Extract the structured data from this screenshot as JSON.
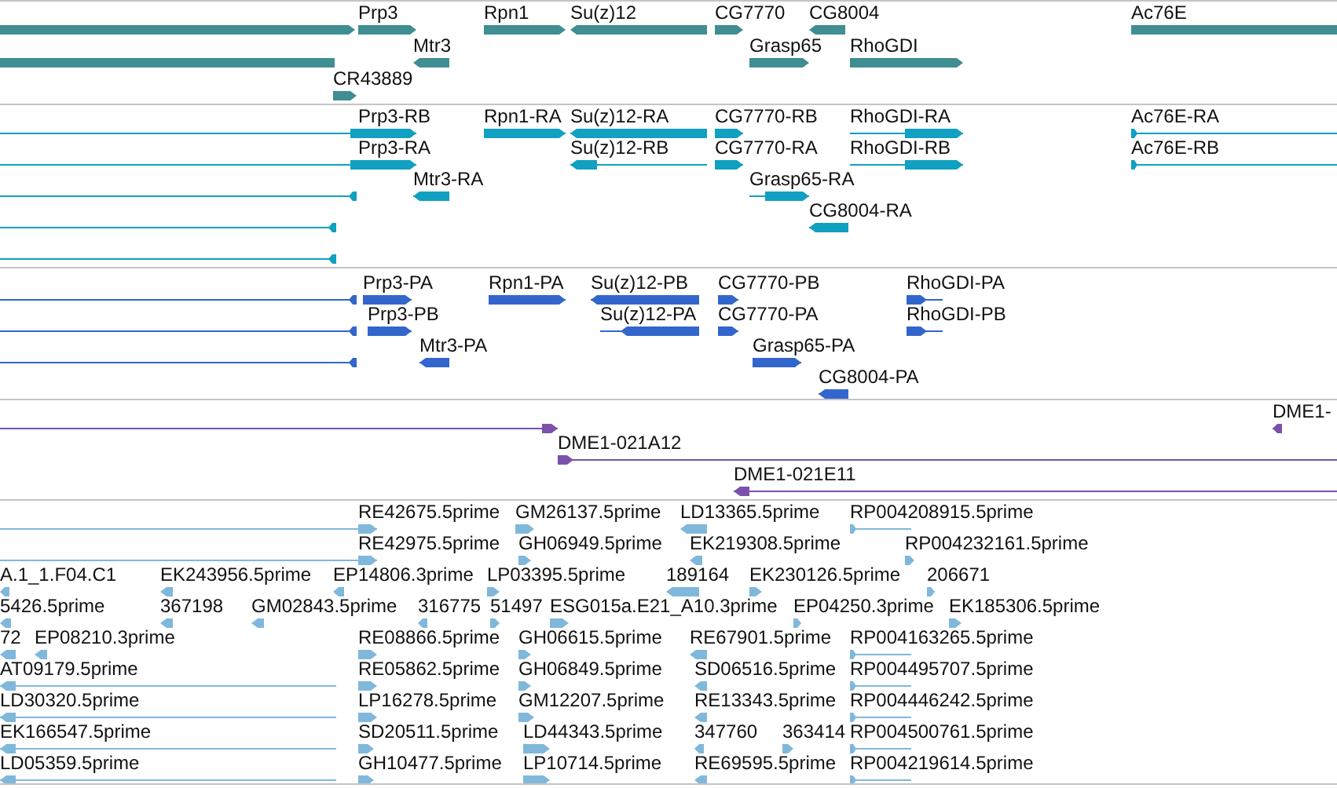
{
  "tracks": [
    {
      "kind": "gene",
      "color": "#3f8e91",
      "features": [
        {
          "reverse": false
        },
        {
          "label": "Prp3",
          "reverse": false
        },
        {
          "label": "Rpn1",
          "reverse": false
        },
        {
          "label": "Su(z)12",
          "reverse": true
        },
        {
          "label": "CG7770",
          "reverse": false
        },
        {
          "label": "CG8004",
          "reverse": true
        },
        {
          "label": "Ac76E",
          "reverse": false
        },
        {
          "reverse": true
        },
        {
          "label": "Mtr3",
          "reverse": true
        },
        {
          "label": "Grasp65",
          "reverse": false
        },
        {
          "label": "RhoGDI",
          "reverse": false
        },
        {
          "label": "CR43889",
          "reverse": false
        }
      ]
    },
    {
      "kind": "transcript",
      "color": "#10a0c0",
      "features": [
        {
          "label": "Prp3-RB",
          "reverse": false
        },
        {
          "label": "Rpn1-RA",
          "reverse": false
        },
        {
          "label": "Su(z)12-RA",
          "reverse": true
        },
        {
          "label": "CG7770-RB",
          "reverse": false
        },
        {
          "label": "RhoGDI-RA",
          "reverse": false
        },
        {
          "label": "Ac76E-RA",
          "reverse": false
        },
        {
          "label": "Prp3-RA",
          "reverse": false
        },
        {
          "label": "Su(z)12-RB",
          "reverse": true
        },
        {
          "label": "CG7770-RA",
          "reverse": false
        },
        {
          "label": "RhoGDI-RB",
          "reverse": false
        },
        {
          "label": "Ac76E-RB",
          "reverse": false
        },
        {
          "reverse": true
        },
        {
          "label": "Mtr3-RA",
          "reverse": true
        },
        {
          "label": "Grasp65-RA",
          "reverse": false
        },
        {
          "reverse": true
        },
        {
          "label": "CG8004-RA",
          "reverse": true
        },
        {
          "reverse": true
        }
      ]
    },
    {
      "kind": "protein",
      "color": "#3366cc",
      "features": [
        {
          "reverse": true
        },
        {
          "label": "Prp3-PA",
          "reverse": false
        },
        {
          "label": "Rpn1-PA",
          "reverse": false
        },
        {
          "label": "Su(z)12-PB",
          "reverse": true
        },
        {
          "label": "CG7770-PB",
          "reverse": false
        },
        {
          "label": "RhoGDI-PA",
          "reverse": false
        },
        {
          "reverse": true
        },
        {
          "label": "Prp3-PB",
          "reverse": false
        },
        {
          "label": "Su(z)12-PA",
          "reverse": true
        },
        {
          "label": "CG7770-PA",
          "reverse": false
        },
        {
          "label": "RhoGDI-PB",
          "reverse": false
        },
        {
          "reverse": true
        },
        {
          "label": "Mtr3-PA",
          "reverse": true
        },
        {
          "label": "Grasp65-PA",
          "reverse": false
        },
        {
          "label": "CG8004-PA",
          "reverse": true
        }
      ]
    },
    {
      "kind": "clone",
      "color": "#7b52ab",
      "features": [
        {
          "reverse": false
        },
        {
          "label": "DME1-",
          "reverse": true
        },
        {
          "label": "DME1-021A12",
          "reverse": false
        },
        {
          "label": "DME1-021E11",
          "reverse": true
        }
      ]
    },
    {
      "kind": "est",
      "color": "#80b8dc",
      "features": [
        {
          "label": "RE42675.5prime",
          "reverse": false
        },
        {
          "label": "GM26137.5prime",
          "reverse": false
        },
        {
          "label": "LD13365.5prime",
          "reverse": true
        },
        {
          "label": "RP004208915.5prime",
          "reverse": false
        },
        {
          "label": "RE42975.5prime",
          "reverse": false
        },
        {
          "label": "GH06949.5prime",
          "reverse": false
        },
        {
          "label": "EK219308.5prime",
          "reverse": true
        },
        {
          "label": "RP004232161.5prime",
          "reverse": false
        },
        {
          "label": "A.1_1.F04.C1",
          "reverse": true
        },
        {
          "label": "EK243956.5prime",
          "reverse": true
        },
        {
          "label": "EP14806.3prime",
          "reverse": true
        },
        {
          "label": "LP03395.5prime",
          "reverse": false
        },
        {
          "label": "189164",
          "reverse": true
        },
        {
          "label": "EK230126.5prime",
          "reverse": false
        },
        {
          "label": "206671",
          "reverse": false
        },
        {
          "label": "5426.5prime",
          "reverse": true
        },
        {
          "label": "367198",
          "reverse": true
        },
        {
          "label": "GM02843.5prime",
          "reverse": true
        },
        {
          "label": "316775",
          "reverse": true
        },
        {
          "label": "51497",
          "reverse": false
        },
        {
          "label": "ESG015a.E21_A10.3prime",
          "reverse": false
        },
        {
          "label": "EP04250.3prime",
          "reverse": false
        },
        {
          "label": "EK185306.5prime",
          "reverse": false
        },
        {
          "label": "72",
          "reverse": true
        },
        {
          "label": "EP08210.3prime",
          "reverse": true
        },
        {
          "label": "RE08866.5prime",
          "reverse": false
        },
        {
          "label": "GH06615.5prime",
          "reverse": false
        },
        {
          "label": "RE67901.5prime",
          "reverse": true
        },
        {
          "label": "RP004163265.5prime",
          "reverse": false
        },
        {
          "label": "AT09179.5prime",
          "reverse": true
        },
        {
          "label": "RE05862.5prime",
          "reverse": false
        },
        {
          "label": "GH06849.5prime",
          "reverse": false
        },
        {
          "label": "SD06516.5prime",
          "reverse": true
        },
        {
          "label": "RP004495707.5prime",
          "reverse": false
        },
        {
          "label": "LD30320.5prime",
          "reverse": true
        },
        {
          "label": "LP16278.5prime",
          "reverse": false
        },
        {
          "label": "GM12207.5prime",
          "reverse": false
        },
        {
          "label": "RE13343.5prime",
          "reverse": true
        },
        {
          "label": "RP004446242.5prime",
          "reverse": false
        },
        {
          "label": "EK166547.5prime",
          "reverse": true
        },
        {
          "label": "SD20511.5prime",
          "reverse": false
        },
        {
          "label": "LD44343.5prime",
          "reverse": false
        },
        {
          "label": "347760",
          "reverse": true
        },
        {
          "label": "363414",
          "reverse": false
        },
        {
          "label": "RP004500761.5prime",
          "reverse": false
        },
        {
          "label": "LD05359.5prime",
          "reverse": true
        },
        {
          "label": "GH10477.5prime",
          "reverse": false
        },
        {
          "label": "LP10714.5prime",
          "reverse": false
        },
        {
          "label": "RE69595.5prime",
          "reverse": true
        },
        {
          "label": "RP004219614.5prime",
          "reverse": false
        }
      ]
    }
  ]
}
